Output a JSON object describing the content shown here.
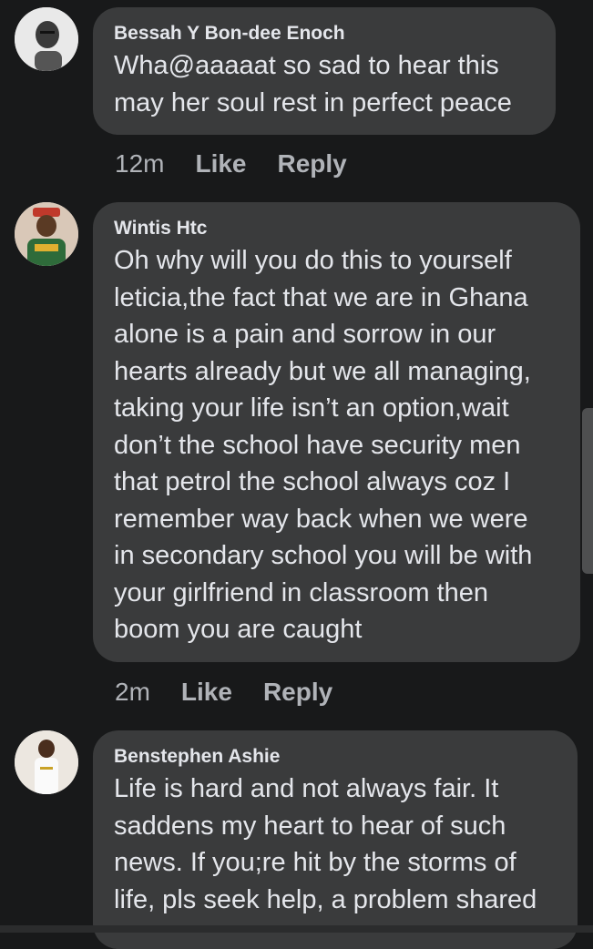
{
  "comments": [
    {
      "author": "Bessah Y Bon-dee Enoch",
      "text": "Wha@aaaaat so sad to hear this\nmay her soul rest in perfect peace",
      "time": "12m",
      "like_label": "Like",
      "reply_label": "Reply"
    },
    {
      "author": "Wintis Htc",
      "text": "Oh why will you do this to yourself\nleticia,the fact that we are in Ghana\nalone is a pain and sorrow in our\nhearts already but we all managing,\ntaking your life isn’t an option,wait\ndon’t the school have security men\nthat petrol the school always coz I\nremember way back when we were\nin secondary school you will be with\nyour girlfriend in classroom then\nboom you are caught",
      "time": "2m",
      "like_label": "Like",
      "reply_label": "Reply"
    },
    {
      "author": "Benstephen Ashie",
      "text": "Life is hard and not always fair. It\nsaddens my heart to hear of such\nnews. If you;re hit by the storms of\nlife, pls seek help, a problem shared"
    }
  ],
  "icons": {
    "avatar_1": "avatar-photo",
    "avatar_2": "avatar-photo",
    "avatar_3": "avatar-photo"
  },
  "colors": {
    "background": "#18191a",
    "bubble": "#3a3b3c",
    "text": "#e4e6eb",
    "secondary_text": "#b0b3b8"
  }
}
